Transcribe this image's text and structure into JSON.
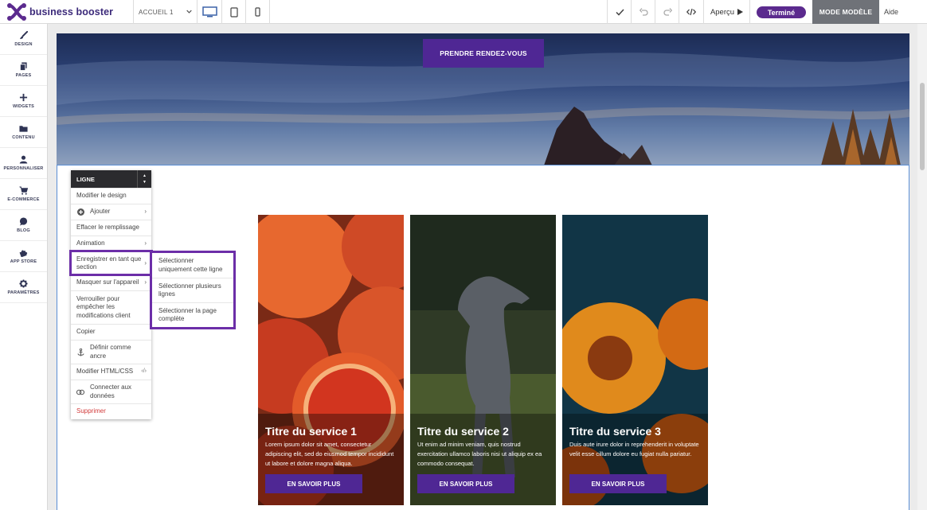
{
  "app": {
    "brand": "business booster"
  },
  "toolbar": {
    "page_selector": "ACCUEIL 1",
    "preview_label": "Aperçu",
    "done_label": "Terminé",
    "template_mode_label": "MODE MODÈLE",
    "help_label": "Aide"
  },
  "sidebar": {
    "items": [
      {
        "label": "DESIGN",
        "icon": "brush-icon"
      },
      {
        "label": "PAGES",
        "icon": "pages-icon"
      },
      {
        "label": "WIDGETS",
        "icon": "plus-icon"
      },
      {
        "label": "CONTENU",
        "icon": "folder-icon"
      },
      {
        "label": "PERSONNALISER",
        "icon": "user-icon"
      },
      {
        "label": "E-COMMERCE",
        "icon": "cart-icon"
      },
      {
        "label": "BLOG",
        "icon": "chat-icon"
      },
      {
        "label": "APP STORE",
        "icon": "puzzle-icon"
      },
      {
        "label": "PARAMÈTRES",
        "icon": "gear-icon"
      }
    ]
  },
  "hero": {
    "cta_label": "PRENDRE RENDEZ-VOUS"
  },
  "services": [
    {
      "title": "Titre du service 1",
      "text": "Lorem ipsum dolor sit amet, consectetur adipiscing elit, sed do eiusmod tempor incididunt ut labore et dolore magna aliqua.",
      "button": "EN SAVOIR PLUS"
    },
    {
      "title": "Titre du service 2",
      "text": "Ut enim ad minim veniam, quis nostrud exercitation ullamco laboris nisi ut aliquip ex ea commodo consequat.",
      "button": "EN SAVOIR PLUS"
    },
    {
      "title": "Titre du service 3",
      "text": "Duis aute irure dolor in reprehenderit in voluptate velit esse cillum dolore eu fugiat nulla pariatur.",
      "button": "EN SAVOIR PLUS"
    }
  ],
  "context_menu": {
    "header": "LIGNE",
    "items": [
      {
        "label": "Modifier le design"
      },
      {
        "label": "Ajouter"
      },
      {
        "label": "Effacer le remplissage"
      },
      {
        "label": "Animation"
      },
      {
        "label": "Enregistrer en tant que section"
      },
      {
        "label": "Masquer sur l'appareil"
      },
      {
        "label": "Verrouiller pour empêcher les modifications client"
      },
      {
        "label": "Copier"
      },
      {
        "label": "Définir comme ancre"
      },
      {
        "label": "Modifier HTML/CSS"
      },
      {
        "label": "Connecter aux données"
      },
      {
        "label": "Supprimer"
      }
    ],
    "submenu": [
      {
        "label": "Sélectionner uniquement cette ligne"
      },
      {
        "label": "Sélectionner plusieurs lignes"
      },
      {
        "label": "Sélectionner la page complète"
      }
    ]
  },
  "colors": {
    "brand_purple": "#4f2794",
    "highlight": "#6c2ea8",
    "selection_blue": "#5b8fd6"
  }
}
